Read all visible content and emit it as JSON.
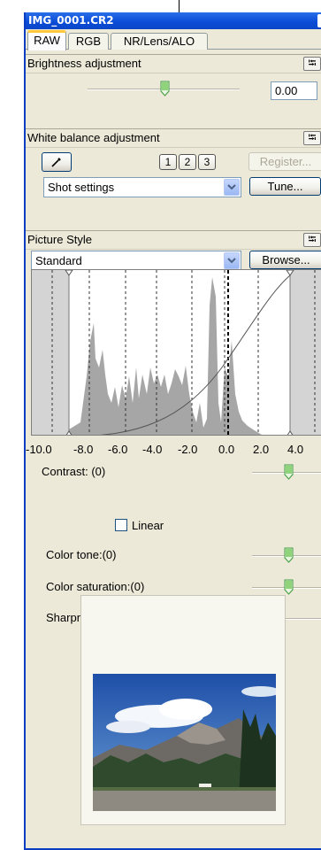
{
  "window": {
    "title": "IMG_0001.CR2"
  },
  "tabs": [
    {
      "label": "RAW",
      "active": true
    },
    {
      "label": "RGB",
      "active": false
    },
    {
      "label": "NR/Lens/ALO",
      "active": false
    }
  ],
  "brightness": {
    "header": "Brightness adjustment",
    "value": "0.00"
  },
  "white_balance": {
    "header": "White balance adjustment",
    "presets": [
      "1",
      "2",
      "3"
    ],
    "register_label": "Register...",
    "mode": "Shot settings",
    "tune_label": "Tune..."
  },
  "picture_style": {
    "header": "Picture Style",
    "style": "Standard",
    "browse_label": "Browse...",
    "axis_ticks": [
      "-10.0",
      "-8.0",
      "-6.0",
      "-4.0",
      "-2.0",
      "0.0",
      "2.0",
      "4.0"
    ],
    "contrast_label": "Contrast: (0)",
    "linear_label": "Linear",
    "linear_checked": false,
    "color_tone_label": "Color tone:(0)",
    "color_saturation_label": "Color saturation:(0)",
    "sharpness_label": "Sharpness:(1)"
  },
  "colors": {
    "title_bar": "#0a4bd6",
    "panel_bg": "#ece9d8",
    "tab_accent": "#ffc83c",
    "histogram_fill": "#a6a6a6"
  },
  "icons": {
    "eyedropper": "eyedropper-icon",
    "reset": "reset-arrow-icon",
    "dropdown": "chevron-down-icon"
  }
}
